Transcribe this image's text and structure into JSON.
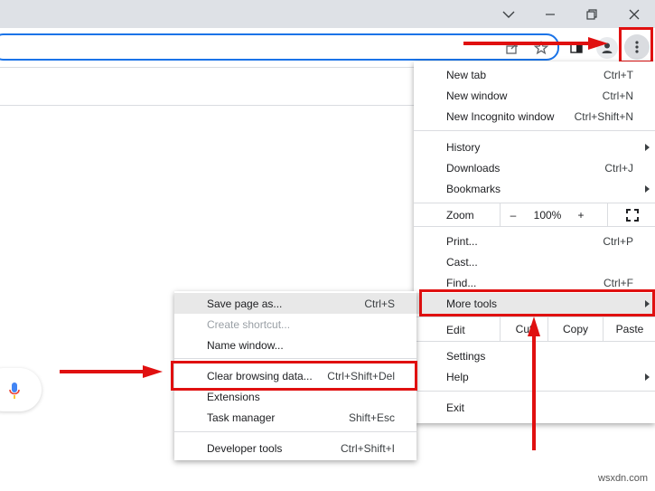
{
  "window_controls": {
    "dropdown_icon": "chevron-down-icon",
    "minimize_icon": "minimize-icon",
    "restore_icon": "restore-icon",
    "close_icon": "close-icon"
  },
  "toolbar_icons": [
    "share-icon",
    "star-icon",
    "side-panel-icon",
    "profile-icon",
    "kebab-menu-icon"
  ],
  "main_menu": {
    "group1": [
      {
        "label": "New tab",
        "shortcut": "Ctrl+T"
      },
      {
        "label": "New window",
        "shortcut": "Ctrl+N"
      },
      {
        "label": "New Incognito window",
        "shortcut": "Ctrl+Shift+N"
      }
    ],
    "group2": [
      {
        "label": "History",
        "submenu": true
      },
      {
        "label": "Downloads",
        "shortcut": "Ctrl+J"
      },
      {
        "label": "Bookmarks",
        "submenu": true
      }
    ],
    "zoom": {
      "label": "Zoom",
      "minus": "–",
      "value": "100%",
      "plus": "+"
    },
    "group3": [
      {
        "label": "Print...",
        "shortcut": "Ctrl+P"
      },
      {
        "label": "Cast..."
      },
      {
        "label": "Find...",
        "shortcut": "Ctrl+F"
      },
      {
        "label": "More tools",
        "submenu": true
      }
    ],
    "edit": {
      "label": "Edit",
      "cut": "Cut",
      "copy": "Copy",
      "paste": "Paste"
    },
    "group4": [
      {
        "label": "Settings"
      },
      {
        "label": "Help",
        "submenu": true
      }
    ],
    "exit": {
      "label": "Exit"
    }
  },
  "more_tools_submenu": [
    {
      "label": "Save page as...",
      "shortcut": "Ctrl+S"
    },
    {
      "label": "Create shortcut...",
      "disabled": true
    },
    {
      "label": "Name window..."
    },
    {
      "label": "Clear browsing data...",
      "shortcut": "Ctrl+Shift+Del"
    },
    {
      "label": "Extensions"
    },
    {
      "label": "Task manager",
      "shortcut": "Shift+Esc"
    },
    {
      "label": "Developer tools",
      "shortcut": "Ctrl+Shift+I"
    }
  ],
  "watermark": "wsxdn.com",
  "colors": {
    "annotation": "#e01010",
    "accent": "#1a73e8",
    "mic_blue": "#4285f4",
    "mic_red": "#ea4335"
  }
}
